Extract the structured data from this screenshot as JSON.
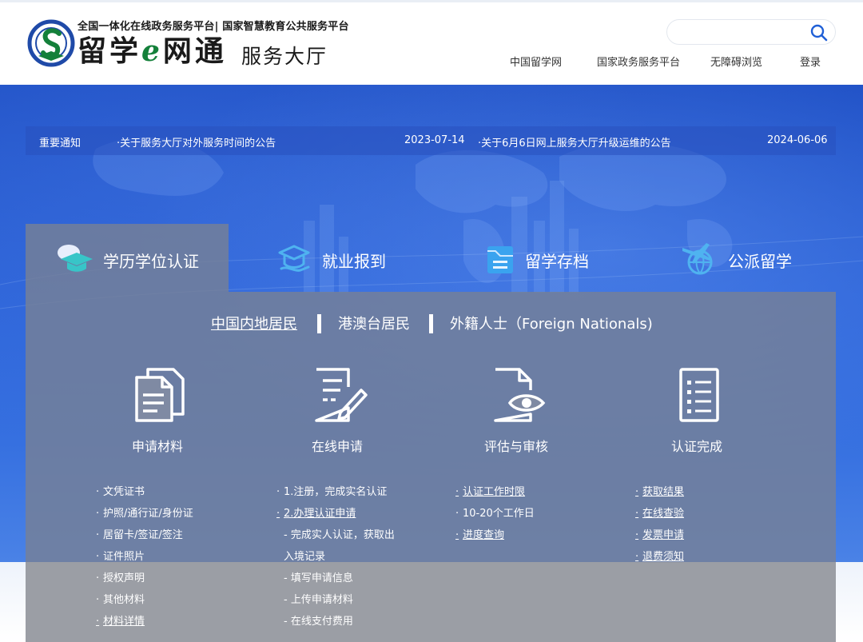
{
  "header": {
    "logo_small": "全国一体化在线政务服务平台| 国家智慧教育公共服务平台",
    "logo_big_1": "留学",
    "logo_big_e": "e",
    "logo_big_2": "网通",
    "logo_sub": "服务大厅",
    "search_placeholder": "",
    "nav": [
      "中国留学网",
      "国家政务服务平台",
      "无障碍浏览",
      "登录"
    ]
  },
  "notice": {
    "title": "重要通知",
    "items": [
      {
        "text": "关于服务大厅对外服务时间的公告",
        "date": "2023-07-14"
      },
      {
        "text": "关于6月6日网上服务大厅升级运维的公告",
        "date": "2024-06-06"
      }
    ]
  },
  "tabs": [
    {
      "label": "学历学位认证",
      "icon": "graduation-cap-icon",
      "active": true
    },
    {
      "label": "就业报到",
      "icon": "cap-hand-icon",
      "active": false
    },
    {
      "label": "留学存档",
      "icon": "archive-folder-icon",
      "active": false
    },
    {
      "label": "公派留学",
      "icon": "airplane-globe-icon",
      "active": false
    }
  ],
  "sub_tabs": [
    "中国内地居民",
    "港澳台居民",
    "外籍人士（Foreign Nationals)"
  ],
  "steps": [
    {
      "title": "申请材料",
      "icon": "documents-icon",
      "links": [
        "文凭证书",
        "护照/通行证/身份证",
        "居留卡/签证/签注",
        "证件照片",
        "授权声明",
        "其他材料",
        "材料详情"
      ]
    },
    {
      "title": "在线申请",
      "icon": "edit-form-icon",
      "links": [
        "1.注册，完成实名认证",
        "2.办理认证申请",
        "- 完成实人认证，获取出",
        "入境记录",
        "- 填写申请信息",
        "- 上传申请材料",
        "- 在线支付费用"
      ]
    },
    {
      "title": "评估与审核",
      "icon": "review-eye-icon",
      "links": [
        "认证工作时限",
        "10-20个工作日",
        "进度查询"
      ]
    },
    {
      "title": "认证完成",
      "icon": "checklist-icon",
      "links": [
        "获取结果",
        "在线查验",
        "发票申请",
        "退费须知"
      ]
    }
  ],
  "colors": {
    "banner": "#2c63d8",
    "panel": "#76809a",
    "logo_green": "#14803a",
    "logo_blue": "#1f4aa8"
  }
}
